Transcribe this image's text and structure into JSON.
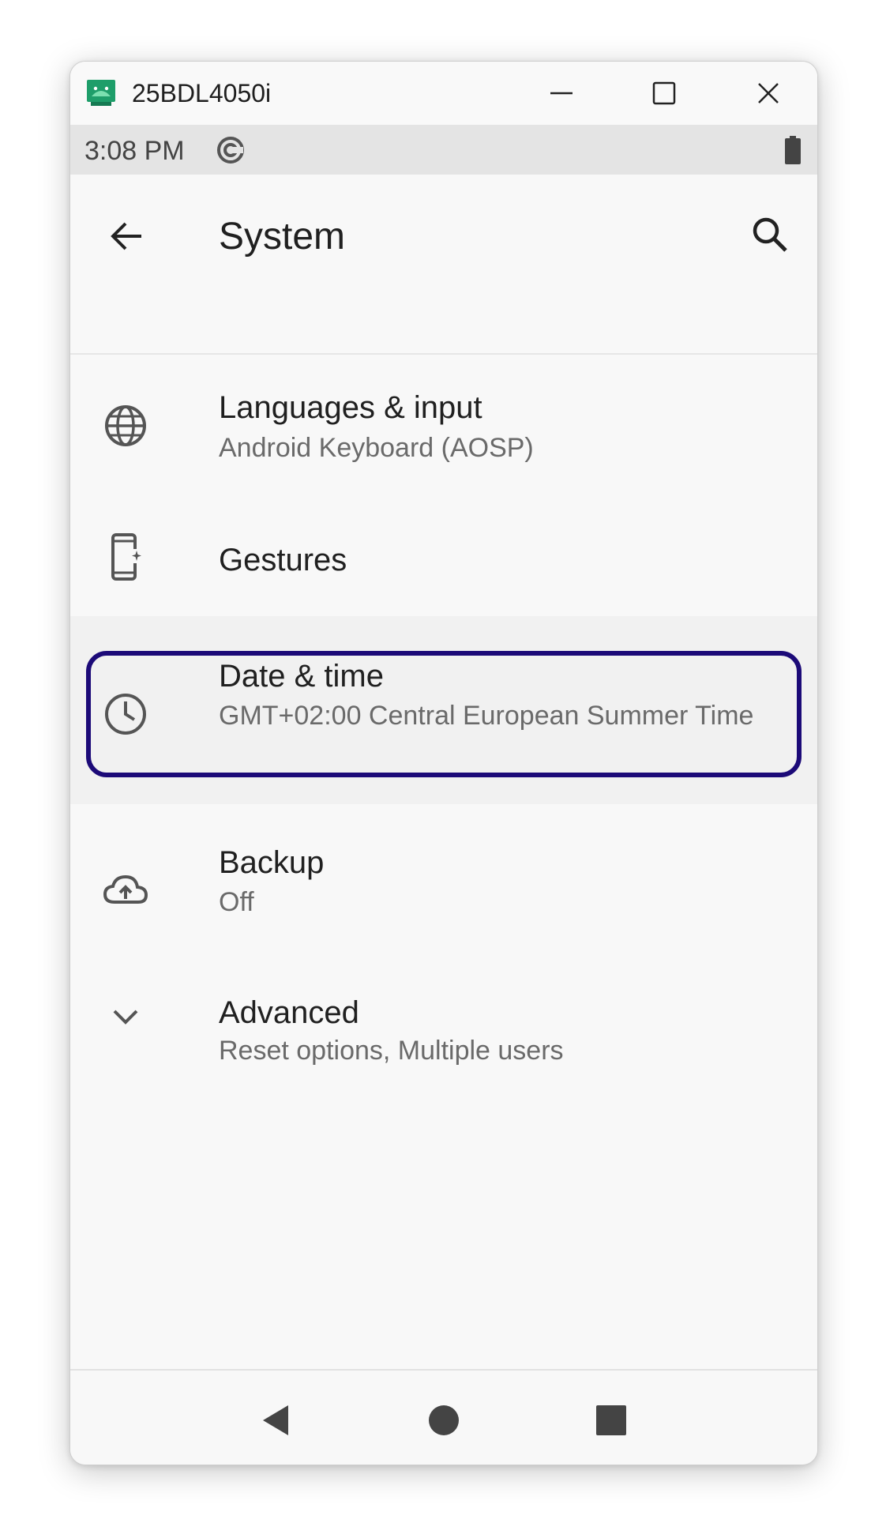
{
  "window": {
    "title": "25BDL4050i",
    "app_icon": "android-icon",
    "accent": "#1c0a78"
  },
  "status_bar": {
    "time": "3:08 PM",
    "icons": [
      "sync-icon",
      "battery-icon"
    ]
  },
  "app_bar": {
    "title": "System",
    "back_icon": "arrow-back-icon",
    "search_icon": "search-icon"
  },
  "items": [
    {
      "icon": "globe-icon",
      "title": "Languages & input",
      "subtitle": "Android Keyboard (AOSP)"
    },
    {
      "icon": "gestures-phone-icon",
      "title": "Gestures",
      "subtitle": ""
    },
    {
      "icon": "clock-icon",
      "title": "Date & time",
      "subtitle": "GMT+02:00 Central European Summer Time",
      "focused": true
    },
    {
      "icon": "cloud-upload-icon",
      "title": "Backup",
      "subtitle": "Off"
    },
    {
      "icon": "chevron-down-icon",
      "title": "Advanced",
      "subtitle": "Reset options, Multiple users"
    }
  ],
  "nav_bar": {
    "buttons": [
      "nav-back-icon",
      "nav-home-icon",
      "nav-recents-icon"
    ]
  }
}
